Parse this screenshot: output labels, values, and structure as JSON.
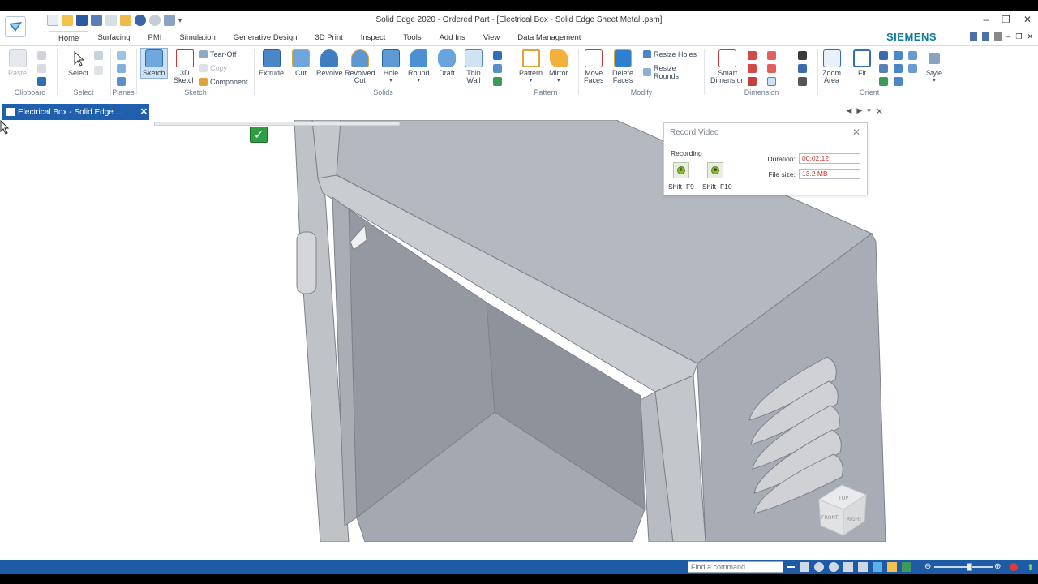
{
  "window": {
    "title": "Solid Edge 2020 - Ordered Part - [Electrical Box -  Solid Edge Sheet Metal .psm]",
    "brand": "SIEMENS"
  },
  "tabs": [
    "Home",
    "Surfacing",
    "PMI",
    "Simulation",
    "Generative Design",
    "3D Print",
    "Inspect",
    "Tools",
    "Add Ins",
    "View",
    "Data Management"
  ],
  "ribbon": {
    "clipboard": {
      "label": "Clipboard",
      "paste": "Paste"
    },
    "select": {
      "label": "Select",
      "select": "Select"
    },
    "planes": {
      "label": "Planes"
    },
    "sketch": {
      "label": "Sketch",
      "sketch": "Sketch",
      "sketch3d_1": "3D",
      "sketch3d_2": "Sketch",
      "tear_off": "Tear-Off",
      "copy": "Copy",
      "component": "Component"
    },
    "solids": {
      "label": "Solids",
      "extrude": "Extrude",
      "cut": "Cut",
      "revolve": "Revolve",
      "revolved_cut_1": "Revolved",
      "revolved_cut_2": "Cut",
      "hole": "Hole",
      "round": "Round",
      "draft": "Draft",
      "thin_wall_1": "Thin",
      "thin_wall_2": "Wall"
    },
    "pattern": {
      "label": "Pattern",
      "pattern": "Pattern",
      "mirror": "Mirror"
    },
    "modify": {
      "label": "Modify",
      "move_faces_1": "Move",
      "move_faces_2": "Faces",
      "delete_faces_1": "Delete",
      "delete_faces_2": "Faces",
      "resize_holes": "Resize Holes",
      "resize_rounds": "Resize Rounds"
    },
    "dimension": {
      "label": "Dimension",
      "smart_dimension_1": "Smart",
      "smart_dimension_2": "Dimension"
    },
    "orient": {
      "label": "Orient",
      "zoom_area_1": "Zoom",
      "zoom_area_2": "Area",
      "fit": "Fit"
    },
    "style": {
      "style": "Style"
    }
  },
  "document_tab": {
    "title": "Electrical Box -  Solid Edge ..."
  },
  "record_video": {
    "title": "Record Video",
    "status": "Recording",
    "pause_key": "Shift+F9",
    "stop_key": "Shift+F10",
    "duration_label": "Duration:",
    "duration_value": "00:02:12",
    "filesize_label": "File size:",
    "filesize_value": "13.2 MB"
  },
  "statusbar": {
    "command_placeholder": "Find a command"
  },
  "view_cube": {
    "top": "TOP",
    "front": "FRONT",
    "right": "RIGHT"
  },
  "colors": {
    "accent": "#1e5ba6",
    "brand": "#0e7c9a",
    "model_face": "#b9bcc2",
    "record_value": "#c0392b"
  }
}
